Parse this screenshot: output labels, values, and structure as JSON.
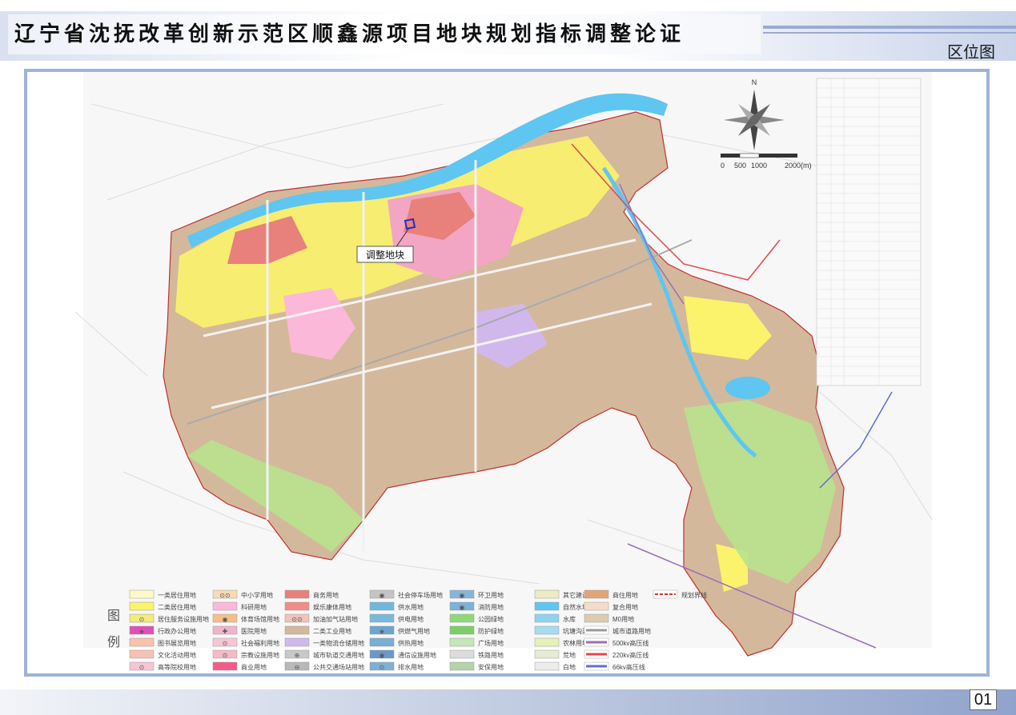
{
  "header": {
    "title": "辽宁省沈抚改革创新示范区顺鑫源项目地块规划指标调整论证",
    "section_label": "区位图"
  },
  "page_number": "01",
  "map": {
    "callout_label": "调整地块",
    "scale": {
      "ticks": [
        "0",
        "500",
        "1000",
        "2000(m)"
      ]
    },
    "north_label": "N"
  },
  "legend": {
    "title_chars": [
      "图",
      "例"
    ],
    "items": [
      {
        "label": "一类居住用地",
        "color": "#fff9c8",
        "symbol": ""
      },
      {
        "label": "二类居住用地",
        "color": "#fbf36b",
        "symbol": ""
      },
      {
        "label": "居住服务设施用地",
        "color": "#f3ec7a",
        "symbol": "⊙"
      },
      {
        "label": "行政办公用地",
        "color": "#e14fb5",
        "symbol": "◈"
      },
      {
        "label": "图书展览用地",
        "color": "#f8c3ad",
        "symbol": ""
      },
      {
        "label": "文化活动用地",
        "color": "#f6c1b5",
        "symbol": ""
      },
      {
        "label": "高等院校用地",
        "color": "#f8c4d6",
        "symbol": "⊙"
      },
      {
        "label": "中小学用地",
        "color": "#f8dab4",
        "symbol": "⊙⊙"
      },
      {
        "label": "科研用地",
        "color": "#fcb8d9",
        "symbol": ""
      },
      {
        "label": "体育场馆用地",
        "color": "#f5c088",
        "symbol": "◉"
      },
      {
        "label": "医院用地",
        "color": "#f3b2cb",
        "symbol": "✚"
      },
      {
        "label": "社会福利用地",
        "color": "#f7c6d4",
        "symbol": "⊙"
      },
      {
        "label": "宗教设施用地",
        "color": "#f6bac6",
        "symbol": "⊙"
      },
      {
        "label": "商业用地",
        "color": "#f45b8a",
        "symbol": ""
      },
      {
        "label": "商务用地",
        "color": "#e8807b",
        "symbol": ""
      },
      {
        "label": "娱乐康体用地",
        "color": "#f08d86",
        "symbol": ""
      },
      {
        "label": "加油加气站用地",
        "color": "#efc3ba",
        "symbol": "⊙⊙"
      },
      {
        "label": "二类工业用地",
        "color": "#d4b89b",
        "symbol": ""
      },
      {
        "label": "一类物流仓储用地",
        "color": "#d1b8ec",
        "symbol": ""
      },
      {
        "label": "城市轨道交通用地",
        "color": "#c8c8c8",
        "symbol": "⊕"
      },
      {
        "label": "公共交通场站用地",
        "color": "#b8b8b8",
        "symbol": "⊖"
      },
      {
        "label": "社会停车场用地",
        "color": "#c4c4c4",
        "symbol": "◉"
      },
      {
        "label": "供水用地",
        "color": "#6fb8dc",
        "symbol": ""
      },
      {
        "label": "供电用地",
        "color": "#78b9dc",
        "symbol": ""
      },
      {
        "label": "供燃气用地",
        "color": "#6aa6cf",
        "symbol": "◈"
      },
      {
        "label": "供热用地",
        "color": "#7aaed2",
        "symbol": ""
      },
      {
        "label": "通信设施用地",
        "color": "#6c98c8",
        "symbol": "◉"
      },
      {
        "label": "排水用地",
        "color": "#80b0d4",
        "symbol": "⊙"
      },
      {
        "label": "环卫用地",
        "color": "#85b6d7",
        "symbol": "◉"
      },
      {
        "label": "消防用地",
        "color": "#7eb1d6",
        "symbol": "◉"
      },
      {
        "label": "公园绿地",
        "color": "#8fd879",
        "symbol": ""
      },
      {
        "label": "防护绿地",
        "color": "#7ccf66",
        "symbol": ""
      },
      {
        "label": "广场用地",
        "color": "#c5e6b8",
        "symbol": ""
      },
      {
        "label": "铁路用地",
        "color": "#dcdcdc",
        "symbol": ""
      },
      {
        "label": "安保用地",
        "color": "#b5d2a8",
        "symbol": ""
      },
      {
        "label": "其它建设用地",
        "color": "#ecebc2",
        "symbol": ""
      },
      {
        "label": "自然水域",
        "color": "#5ec6f0",
        "symbol": ""
      },
      {
        "label": "水库",
        "color": "#8fd2f2",
        "symbol": ""
      },
      {
        "label": "坑塘沟渠",
        "color": "#a5dcf2",
        "symbol": ""
      },
      {
        "label": "农林用地",
        "color": "#e6f1b6",
        "symbol": ""
      },
      {
        "label": "荒地",
        "color": "#e5ecd4",
        "symbol": ""
      },
      {
        "label": "白地",
        "color": "#ececec",
        "symbol": ""
      },
      {
        "label": "商住用地",
        "color": "#e0a577",
        "symbol": ""
      },
      {
        "label": "复合用地",
        "color": "#f6dcc8",
        "symbol": ""
      },
      {
        "label": "M0用地",
        "color": "#d9ccb0",
        "symbol": ""
      },
      {
        "label": "城市道路用地",
        "color": "#ffffff",
        "symbol": "line-gray"
      },
      {
        "label": "500kv高压线",
        "color": "#9a6fb8",
        "symbol": "line"
      },
      {
        "label": "220kv高压线",
        "color": "#e8454e",
        "symbol": "line"
      },
      {
        "label": "66kv高压线",
        "color": "#5d6fd6",
        "symbol": "line"
      },
      {
        "label": "规划界线",
        "color": "#d03030",
        "symbol": "boundary"
      }
    ]
  },
  "colors": {
    "accent": "#9fb3d6",
    "river": "#5ec6f0",
    "residential": "#fbf36b",
    "industrial": "#d4b89b",
    "green": "#8fd879"
  }
}
